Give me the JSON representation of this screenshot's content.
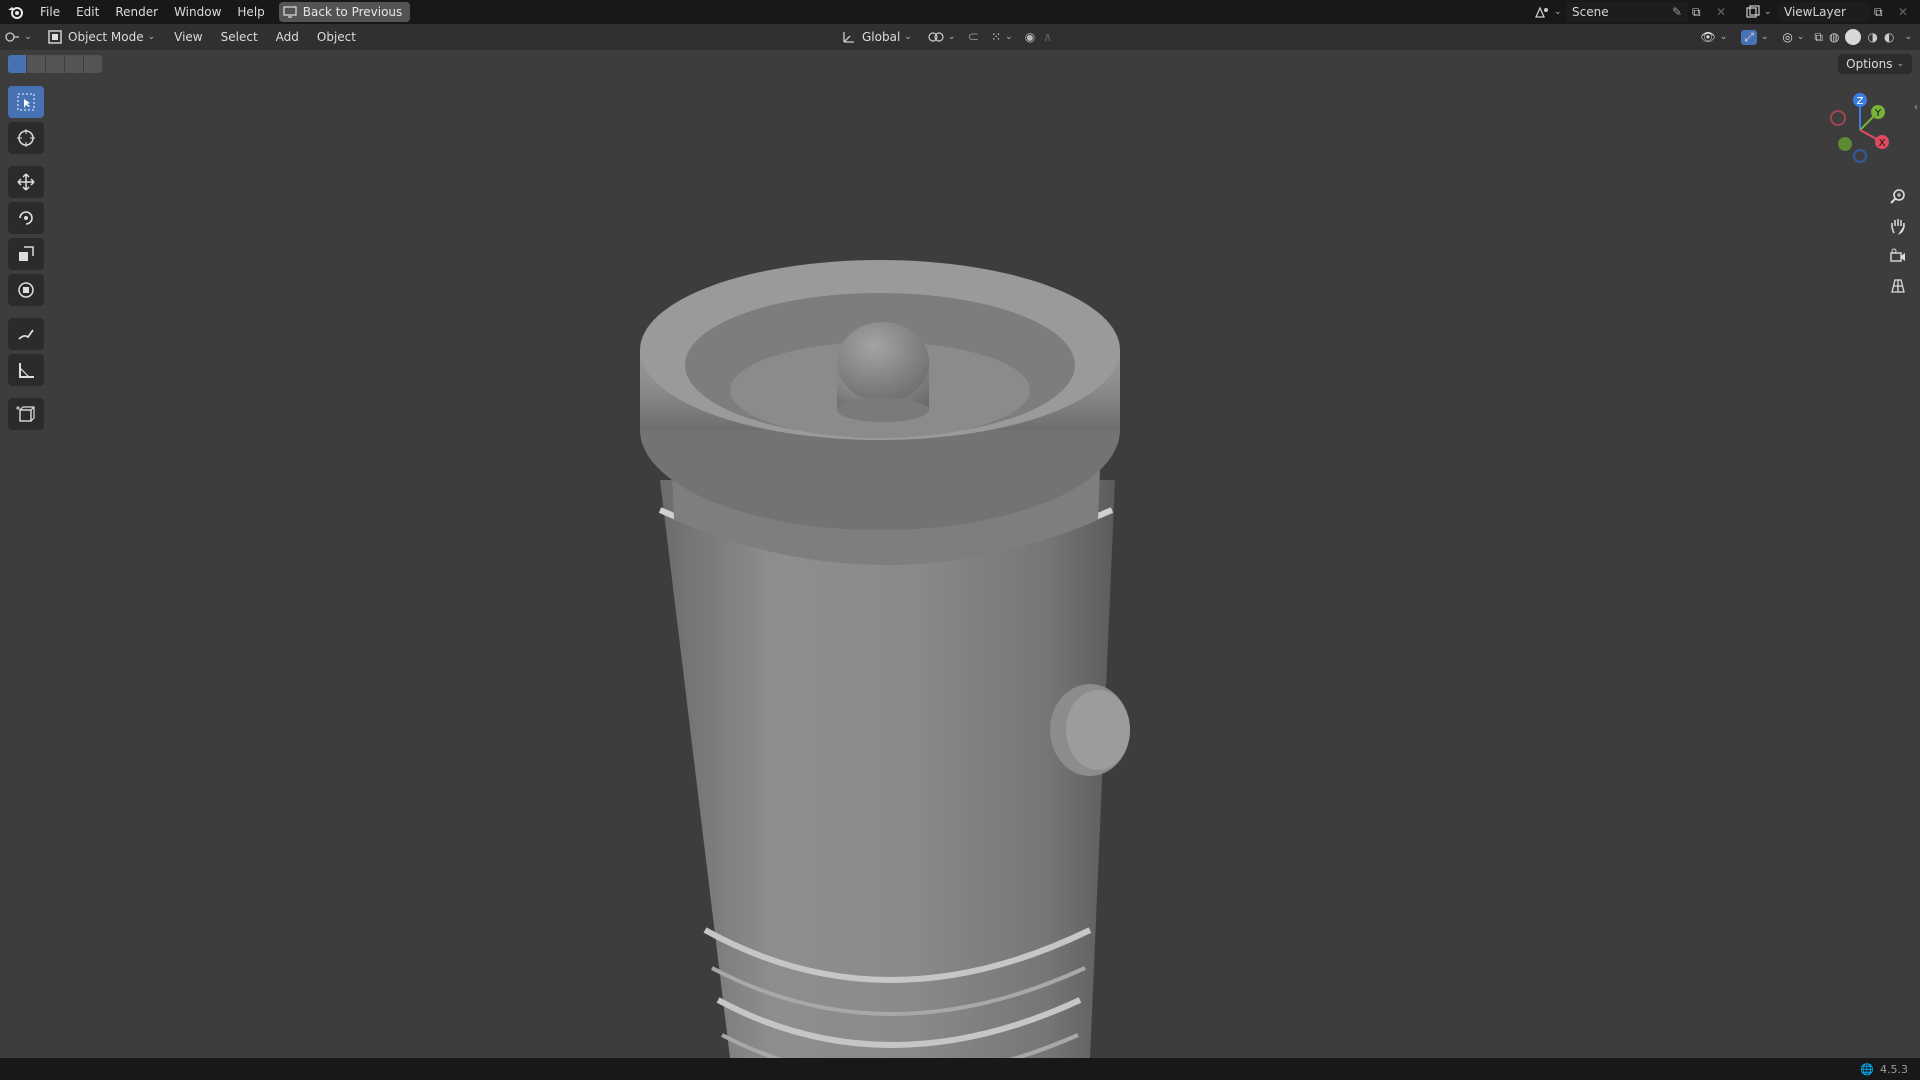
{
  "topbar": {
    "menus": [
      "File",
      "Edit",
      "Render",
      "Window",
      "Help"
    ],
    "back_label": "Back to Previous",
    "scene_label": "Scene",
    "viewlayer_label": "ViewLayer"
  },
  "header": {
    "mode_label": "Object Mode",
    "menus": [
      "View",
      "Select",
      "Add",
      "Object"
    ],
    "transform_label": "Global"
  },
  "viewport": {
    "options_label": "Options",
    "gizmo": {
      "x": "X",
      "y": "Y",
      "z": "Z"
    }
  },
  "statusbar": {
    "version": "4.5.3"
  },
  "colors": {
    "accent": "#4772b3",
    "axis_x": "#e04a5e",
    "axis_y": "#7ab33b",
    "axis_z": "#3b7de0"
  }
}
